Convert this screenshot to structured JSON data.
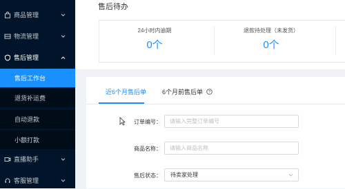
{
  "sidebar": {
    "groups": [
      {
        "label": "商品管理",
        "icon": "shopping-bag-icon"
      },
      {
        "label": "物流管理",
        "icon": "logistics-icon"
      },
      {
        "label": "售后管理",
        "icon": "shield-icon"
      }
    ],
    "subitems": [
      "售后工作台",
      "退货补运费",
      "自动退款",
      "小额打款"
    ],
    "bottom_groups": [
      {
        "label": "直播助手",
        "icon": "video-icon"
      },
      {
        "label": "客服管理",
        "icon": "headset-icon"
      }
    ]
  },
  "pending": {
    "title": "售后待办",
    "kpis": [
      {
        "label": "24小时内逾期",
        "value": "0个"
      },
      {
        "label": "退款待处理（未发货）",
        "value": "0个"
      }
    ]
  },
  "tabs": [
    {
      "label": "近6个月售后单"
    },
    {
      "label": "6个月前售后单"
    }
  ],
  "form": {
    "order_no": {
      "label": "订单编号：",
      "placeholder": "请输入完整订单编号"
    },
    "product_name": {
      "label": "商品名称：",
      "placeholder": "请输入商品名称"
    },
    "status": {
      "label": "售后状态：",
      "value": "待卖家处理"
    }
  },
  "colors": {
    "accent": "#1890ff",
    "sidebar_bg": "#001529"
  }
}
